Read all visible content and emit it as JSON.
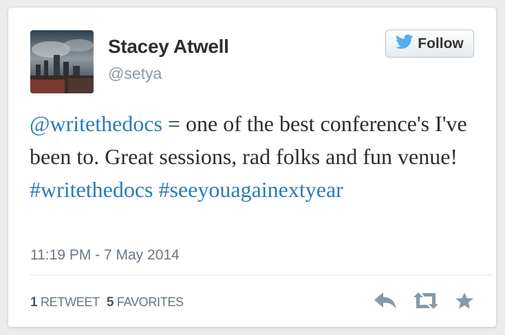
{
  "author": {
    "name": "Stacey Atwell",
    "handle": "@setya"
  },
  "follow_button": {
    "label": "Follow",
    "icon": "twitter-bird-icon"
  },
  "tweet": {
    "mention": "@writethedocs",
    "text_part1": " = one of the best conference's I've been to. Great sessions, rad folks and fun venue! ",
    "hashtag1": "#writethedocs",
    "hashtag2": "#seeyouagainextyear"
  },
  "timestamp": "11:19 PM - 7 May 2014",
  "stats": {
    "retweet_count": "1",
    "retweet_label": "RETWEET",
    "favorite_count": "5",
    "favorite_label": "FAVORITES"
  },
  "actions": [
    "reply-icon",
    "retweet-icon",
    "favorite-star-icon"
  ],
  "colors": {
    "link": "#2b7bb9",
    "twitter_blue": "#55acee",
    "action_icon": "#8899a6"
  }
}
